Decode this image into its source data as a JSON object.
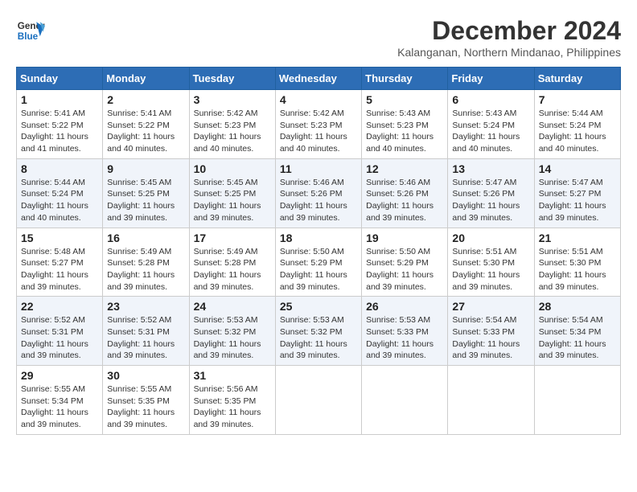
{
  "logo": {
    "line1": "General",
    "line2": "Blue"
  },
  "title": "December 2024",
  "location": "Kalanganan, Northern Mindanao, Philippines",
  "weekdays": [
    "Sunday",
    "Monday",
    "Tuesday",
    "Wednesday",
    "Thursday",
    "Friday",
    "Saturday"
  ],
  "weeks": [
    [
      {
        "day": "1",
        "sunrise": "5:41 AM",
        "sunset": "5:22 PM",
        "daylight": "11 hours and 41 minutes."
      },
      {
        "day": "2",
        "sunrise": "5:41 AM",
        "sunset": "5:22 PM",
        "daylight": "11 hours and 40 minutes."
      },
      {
        "day": "3",
        "sunrise": "5:42 AM",
        "sunset": "5:23 PM",
        "daylight": "11 hours and 40 minutes."
      },
      {
        "day": "4",
        "sunrise": "5:42 AM",
        "sunset": "5:23 PM",
        "daylight": "11 hours and 40 minutes."
      },
      {
        "day": "5",
        "sunrise": "5:43 AM",
        "sunset": "5:23 PM",
        "daylight": "11 hours and 40 minutes."
      },
      {
        "day": "6",
        "sunrise": "5:43 AM",
        "sunset": "5:24 PM",
        "daylight": "11 hours and 40 minutes."
      },
      {
        "day": "7",
        "sunrise": "5:44 AM",
        "sunset": "5:24 PM",
        "daylight": "11 hours and 40 minutes."
      }
    ],
    [
      {
        "day": "8",
        "sunrise": "5:44 AM",
        "sunset": "5:24 PM",
        "daylight": "11 hours and 40 minutes."
      },
      {
        "day": "9",
        "sunrise": "5:45 AM",
        "sunset": "5:25 PM",
        "daylight": "11 hours and 39 minutes."
      },
      {
        "day": "10",
        "sunrise": "5:45 AM",
        "sunset": "5:25 PM",
        "daylight": "11 hours and 39 minutes."
      },
      {
        "day": "11",
        "sunrise": "5:46 AM",
        "sunset": "5:26 PM",
        "daylight": "11 hours and 39 minutes."
      },
      {
        "day": "12",
        "sunrise": "5:46 AM",
        "sunset": "5:26 PM",
        "daylight": "11 hours and 39 minutes."
      },
      {
        "day": "13",
        "sunrise": "5:47 AM",
        "sunset": "5:26 PM",
        "daylight": "11 hours and 39 minutes."
      },
      {
        "day": "14",
        "sunrise": "5:47 AM",
        "sunset": "5:27 PM",
        "daylight": "11 hours and 39 minutes."
      }
    ],
    [
      {
        "day": "15",
        "sunrise": "5:48 AM",
        "sunset": "5:27 PM",
        "daylight": "11 hours and 39 minutes."
      },
      {
        "day": "16",
        "sunrise": "5:49 AM",
        "sunset": "5:28 PM",
        "daylight": "11 hours and 39 minutes."
      },
      {
        "day": "17",
        "sunrise": "5:49 AM",
        "sunset": "5:28 PM",
        "daylight": "11 hours and 39 minutes."
      },
      {
        "day": "18",
        "sunrise": "5:50 AM",
        "sunset": "5:29 PM",
        "daylight": "11 hours and 39 minutes."
      },
      {
        "day": "19",
        "sunrise": "5:50 AM",
        "sunset": "5:29 PM",
        "daylight": "11 hours and 39 minutes."
      },
      {
        "day": "20",
        "sunrise": "5:51 AM",
        "sunset": "5:30 PM",
        "daylight": "11 hours and 39 minutes."
      },
      {
        "day": "21",
        "sunrise": "5:51 AM",
        "sunset": "5:30 PM",
        "daylight": "11 hours and 39 minutes."
      }
    ],
    [
      {
        "day": "22",
        "sunrise": "5:52 AM",
        "sunset": "5:31 PM",
        "daylight": "11 hours and 39 minutes."
      },
      {
        "day": "23",
        "sunrise": "5:52 AM",
        "sunset": "5:31 PM",
        "daylight": "11 hours and 39 minutes."
      },
      {
        "day": "24",
        "sunrise": "5:53 AM",
        "sunset": "5:32 PM",
        "daylight": "11 hours and 39 minutes."
      },
      {
        "day": "25",
        "sunrise": "5:53 AM",
        "sunset": "5:32 PM",
        "daylight": "11 hours and 39 minutes."
      },
      {
        "day": "26",
        "sunrise": "5:53 AM",
        "sunset": "5:33 PM",
        "daylight": "11 hours and 39 minutes."
      },
      {
        "day": "27",
        "sunrise": "5:54 AM",
        "sunset": "5:33 PM",
        "daylight": "11 hours and 39 minutes."
      },
      {
        "day": "28",
        "sunrise": "5:54 AM",
        "sunset": "5:34 PM",
        "daylight": "11 hours and 39 minutes."
      }
    ],
    [
      {
        "day": "29",
        "sunrise": "5:55 AM",
        "sunset": "5:34 PM",
        "daylight": "11 hours and 39 minutes."
      },
      {
        "day": "30",
        "sunrise": "5:55 AM",
        "sunset": "5:35 PM",
        "daylight": "11 hours and 39 minutes."
      },
      {
        "day": "31",
        "sunrise": "5:56 AM",
        "sunset": "5:35 PM",
        "daylight": "11 hours and 39 minutes."
      },
      null,
      null,
      null,
      null
    ]
  ]
}
